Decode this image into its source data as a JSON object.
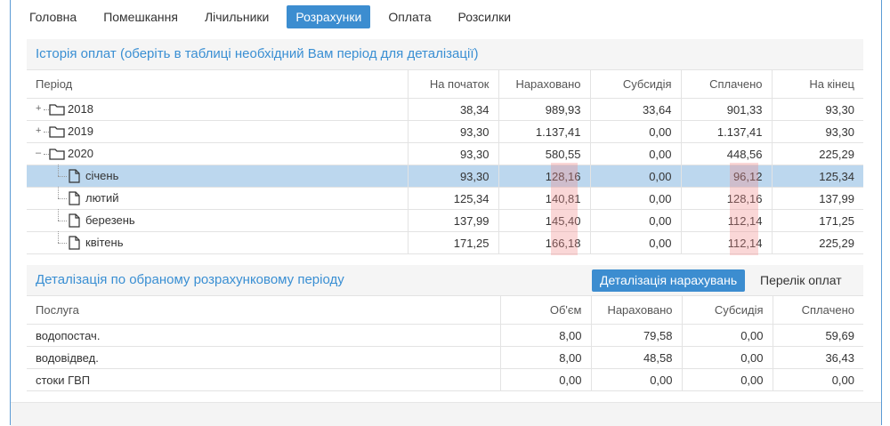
{
  "tabs": [
    "Головна",
    "Помешкання",
    "Лічильники",
    "Розрахунки",
    "Оплата",
    "Розсилки"
  ],
  "active_tab": 3,
  "history": {
    "title": "Історія оплат (оберіть в таблиці необхідний Вам період для деталізації)",
    "columns": [
      "Період",
      "На початок",
      "Нараховано",
      "Субсидія",
      "Сплачено",
      "На кінец"
    ],
    "rows": [
      {
        "label": "2018",
        "type": "folder",
        "expanded": false,
        "values": [
          "38,34",
          "989,93",
          "33,64",
          "901,33",
          "93,30"
        ]
      },
      {
        "label": "2019",
        "type": "folder",
        "expanded": false,
        "values": [
          "93,30",
          "1.137,41",
          "0,00",
          "1.137,41",
          "93,30"
        ]
      },
      {
        "label": "2020",
        "type": "folder",
        "expanded": true,
        "values": [
          "93,30",
          "580,55",
          "0,00",
          "448,56",
          "225,29"
        ]
      },
      {
        "label": "січень",
        "type": "file",
        "selected": true,
        "values": [
          "93,30",
          "128,16",
          "0,00",
          "96,12",
          "125,34"
        ]
      },
      {
        "label": "лютий",
        "type": "file",
        "values": [
          "125,34",
          "140,81",
          "0,00",
          "128,16",
          "137,99"
        ]
      },
      {
        "label": "березень",
        "type": "file",
        "values": [
          "137,99",
          "145,40",
          "0,00",
          "112,14",
          "171,25"
        ]
      },
      {
        "label": "квітень",
        "type": "file",
        "values": [
          "171,25",
          "166,18",
          "0,00",
          "112,14",
          "225,29"
        ]
      }
    ]
  },
  "detail": {
    "title": "Деталізація по обраному розрахунковому періоду",
    "btn_charges": "Деталізація нарахувань",
    "btn_payments": "Перелік оплат",
    "columns": [
      "Послуга",
      "Об'єм",
      "Нараховано",
      "Субсидія",
      "Сплачено"
    ],
    "rows": [
      {
        "service": "водопостач.",
        "values": [
          "8,00",
          "79,58",
          "0,00",
          "59,69"
        ]
      },
      {
        "service": "водовідвед.",
        "values": [
          "8,00",
          "48,58",
          "0,00",
          "36,43"
        ]
      },
      {
        "service": "стоки ГВП",
        "values": [
          "0,00",
          "0,00",
          "0,00",
          "0,00"
        ]
      }
    ]
  },
  "colors": {
    "accent": "#3c8dd0",
    "title": "#3a8fd3",
    "selected_row": "#bcd7ee",
    "highlight": "#f08c8c"
  }
}
